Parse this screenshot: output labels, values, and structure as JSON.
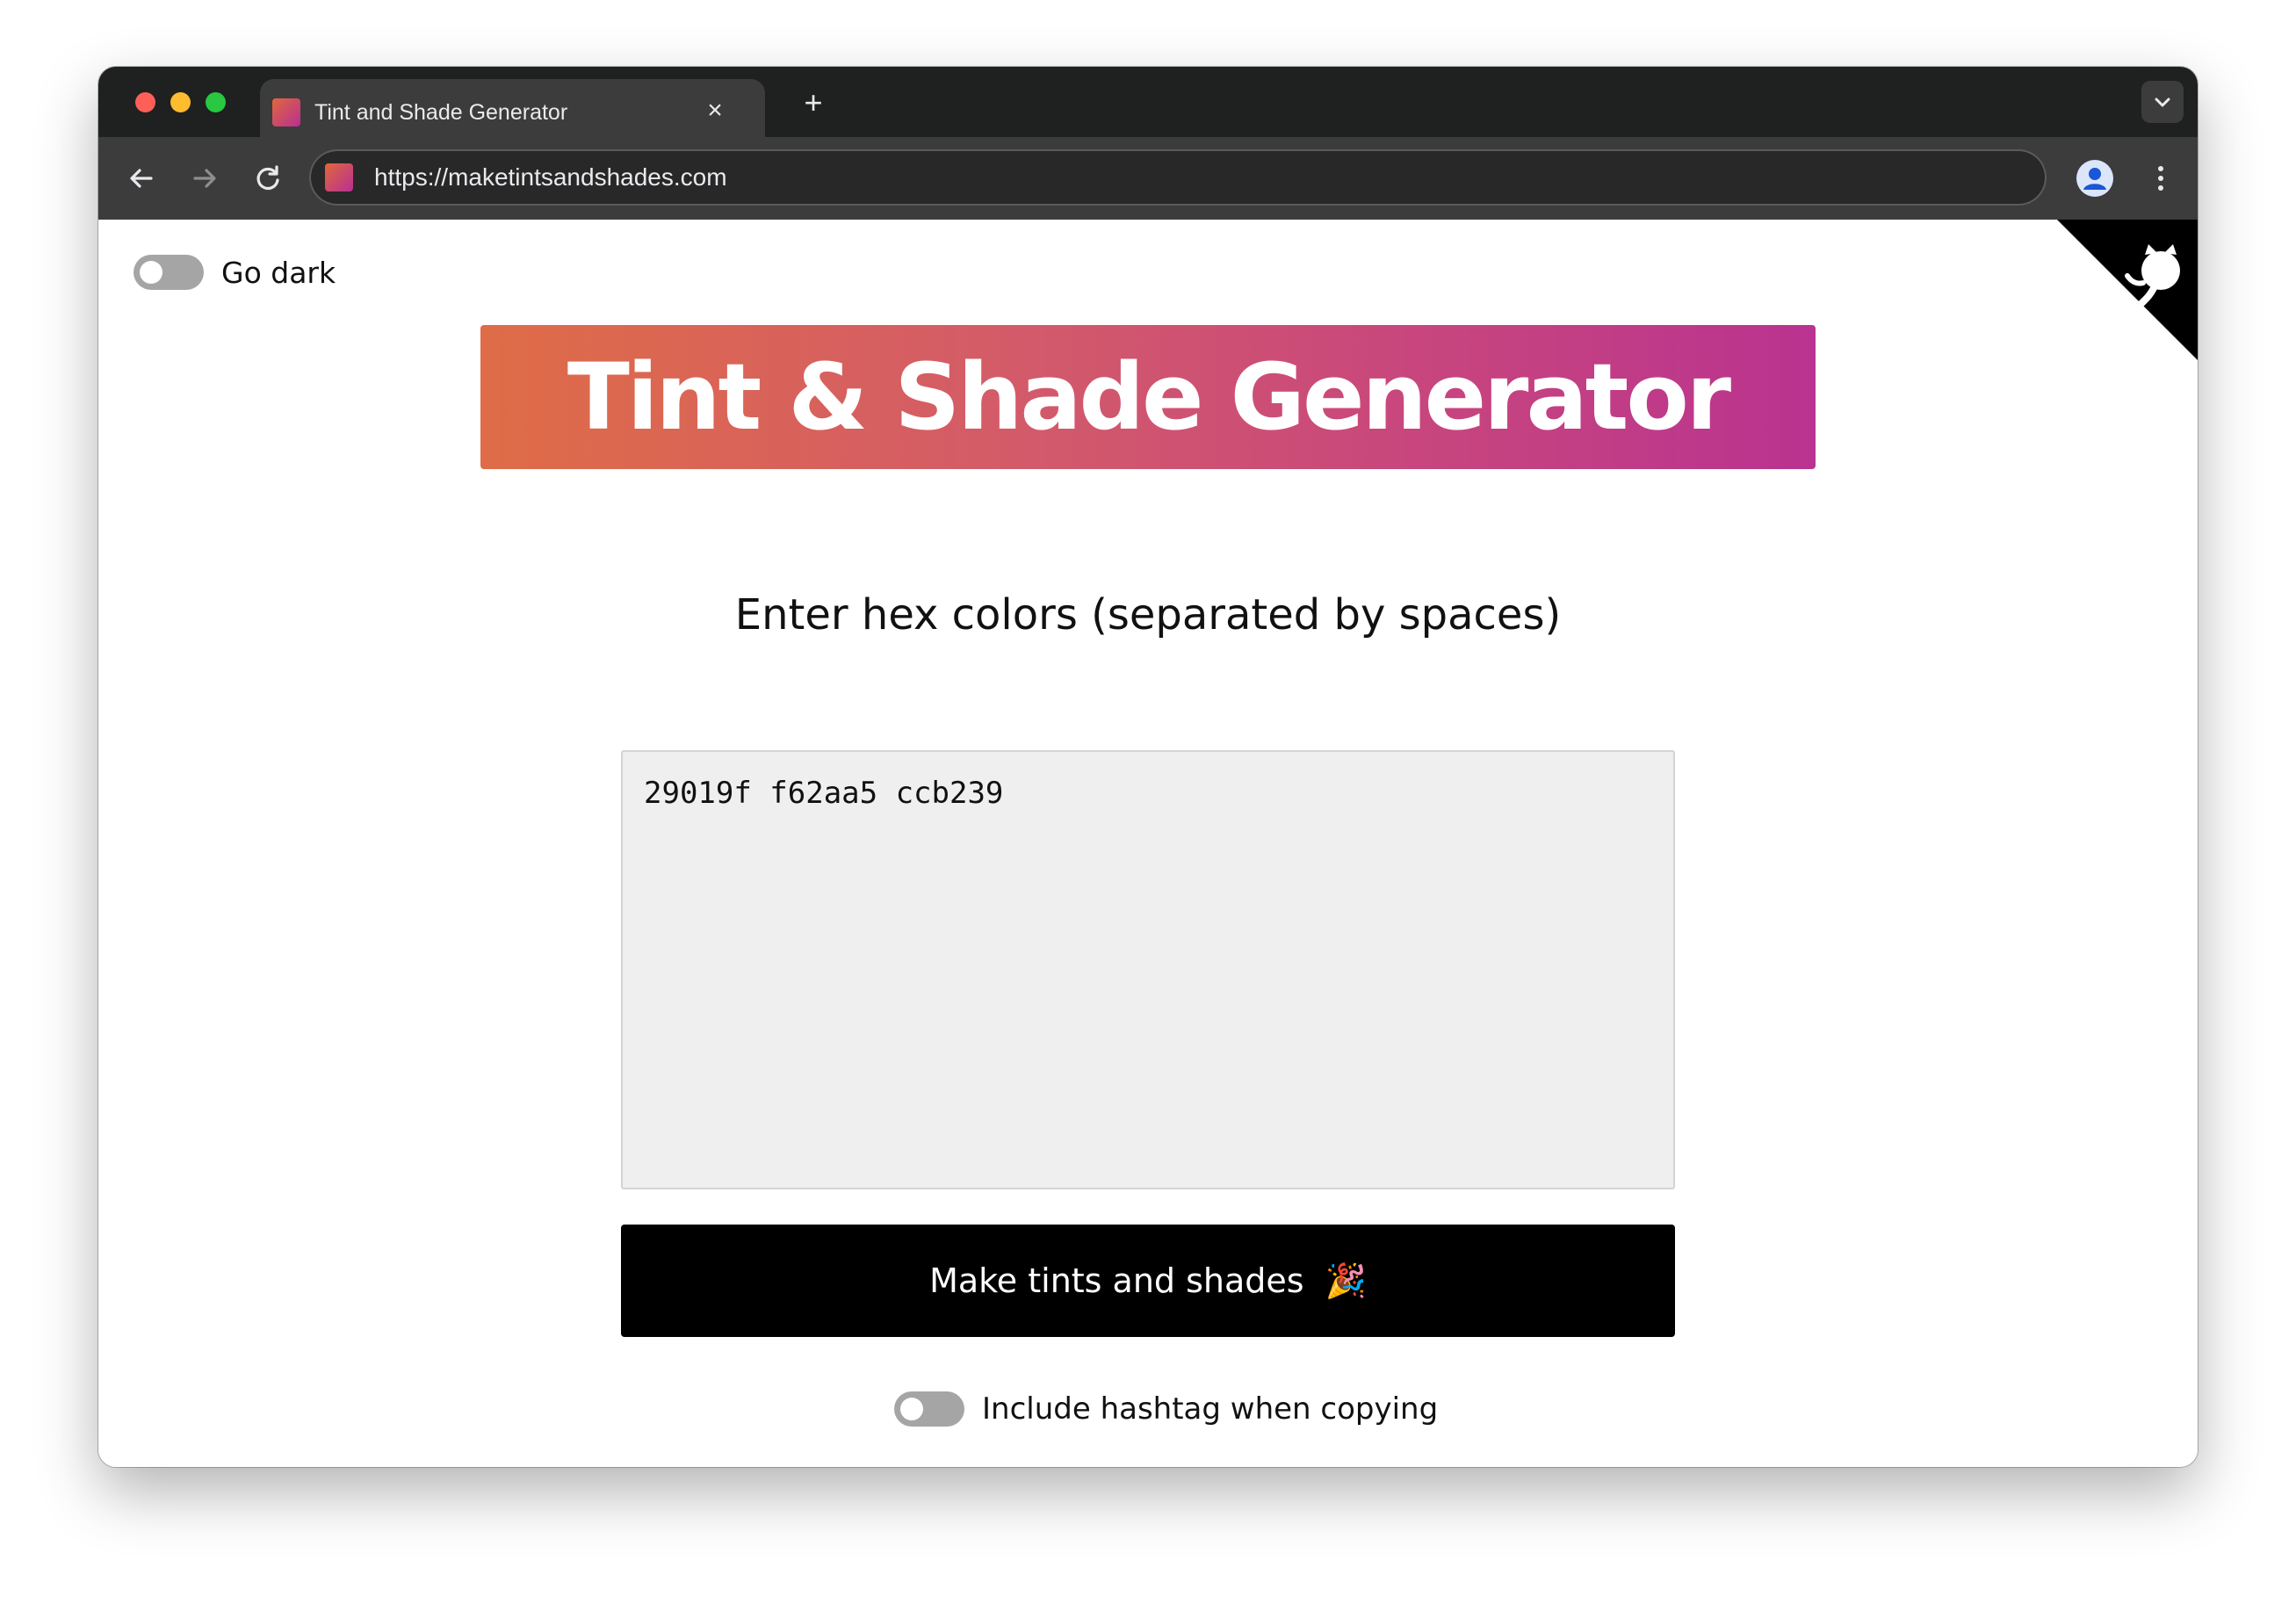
{
  "browser": {
    "tab_title": "Tint and Shade Generator",
    "tab_close_icon": "×",
    "new_tab_icon": "+",
    "url": "https://maketintsandshades.com"
  },
  "page": {
    "dark_toggle_label": "Go dark",
    "banner_title": "Tint & Shade Generator",
    "prompt": "Enter hex colors (separated by spaces)",
    "hex_value": "29019f f62aa5 ccb239",
    "make_button_label": "Make tints and shades",
    "make_button_emoji": "🎉",
    "hashtag_toggle_label": "Include hashtag when copying"
  },
  "colors": {
    "banner_gradient_start": "#df6c47",
    "banner_gradient_end": "#b93390",
    "button_background": "#000000",
    "toggle_off": "#a5a5a5"
  },
  "icons": {
    "back": "arrow-left-icon",
    "forward": "arrow-right-icon",
    "reload": "reload-icon",
    "profile": "profile-icon",
    "menu": "kebab-menu-icon",
    "corner": "github-octocat-icon"
  }
}
